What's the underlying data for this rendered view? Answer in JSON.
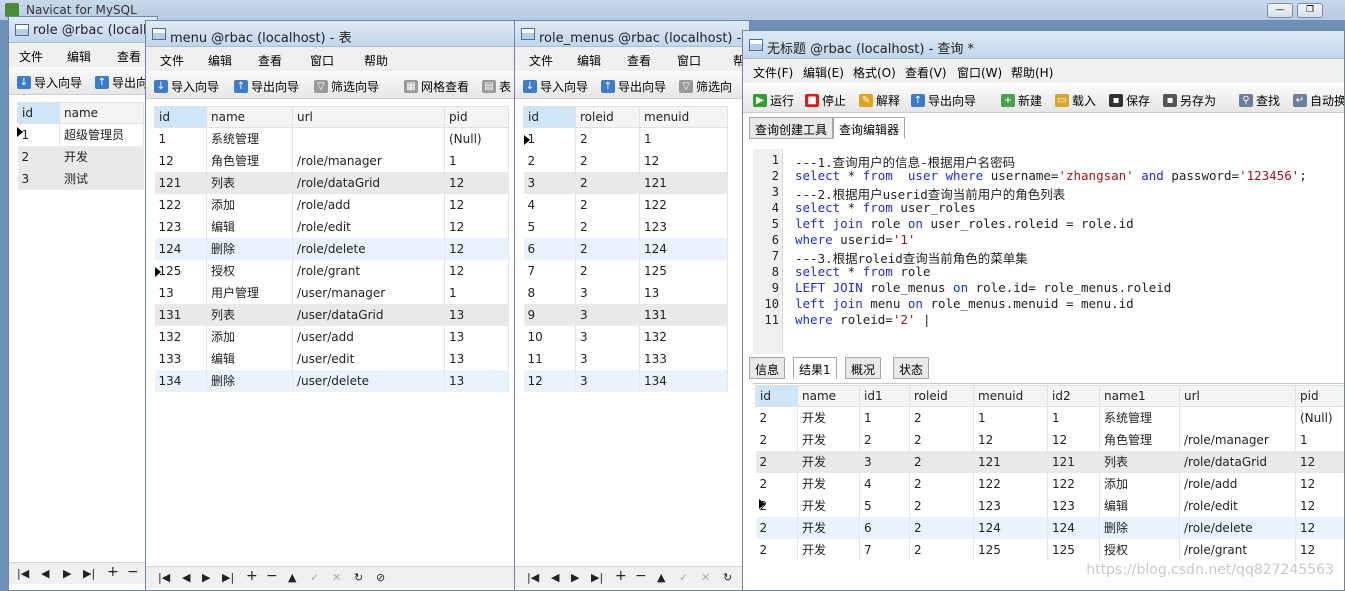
{
  "app": {
    "title": "Navicat for MySQL"
  },
  "role_window": {
    "title": "role @rbac (localhost)",
    "menu": [
      "文件",
      "编辑",
      "查看"
    ],
    "toolbar": [
      "导入向导",
      "导出向导"
    ],
    "columns": [
      "id",
      "name"
    ],
    "rows": [
      [
        "1",
        "超级管理员"
      ],
      [
        "2",
        "开发"
      ],
      [
        "3",
        "测试"
      ]
    ]
  },
  "menu_window": {
    "title": "menu @rbac (localhost) - 表",
    "menu": [
      "文件",
      "编辑",
      "查看",
      "窗口",
      "帮助"
    ],
    "toolbar": [
      "导入向导",
      "导出向导",
      "筛选向导",
      "网格查看",
      "表"
    ],
    "columns": [
      "id",
      "name",
      "url",
      "pid"
    ],
    "rows": [
      [
        "1",
        "系统管理",
        "",
        "(Null)"
      ],
      [
        "12",
        "角色管理",
        "/role/manager",
        "1"
      ],
      [
        "121",
        "列表",
        "/role/dataGrid",
        "12"
      ],
      [
        "122",
        "添加",
        "/role/add",
        "12"
      ],
      [
        "123",
        "编辑",
        "/role/edit",
        "12"
      ],
      [
        "124",
        "删除",
        "/role/delete",
        "12"
      ],
      [
        "125",
        "授权",
        "/role/grant",
        "12"
      ],
      [
        "13",
        "用户管理",
        "/user/manager",
        "1"
      ],
      [
        "131",
        "列表",
        "/user/dataGrid",
        "13"
      ],
      [
        "132",
        "添加",
        "/user/add",
        "13"
      ],
      [
        "133",
        "编辑",
        "/user/edit",
        "13"
      ],
      [
        "134",
        "删除",
        "/user/delete",
        "13"
      ]
    ]
  },
  "role_menus_window": {
    "title": "role_menus @rbac (localhost) - 表",
    "menu": [
      "文件",
      "编辑",
      "查看",
      "窗口",
      "帮"
    ],
    "toolbar": [
      "导入向导",
      "导出向导",
      "筛选向"
    ],
    "columns": [
      "id",
      "roleid",
      "menuid"
    ],
    "rows": [
      [
        "1",
        "2",
        "1"
      ],
      [
        "2",
        "2",
        "12"
      ],
      [
        "3",
        "2",
        "121"
      ],
      [
        "4",
        "2",
        "122"
      ],
      [
        "5",
        "2",
        "123"
      ],
      [
        "6",
        "2",
        "124"
      ],
      [
        "7",
        "2",
        "125"
      ],
      [
        "8",
        "3",
        "13"
      ],
      [
        "9",
        "3",
        "131"
      ],
      [
        "10",
        "3",
        "132"
      ],
      [
        "11",
        "3",
        "133"
      ],
      [
        "12",
        "3",
        "134"
      ]
    ]
  },
  "query_window": {
    "title": "无标题 @rbac (localhost) - 查询 *",
    "menu": [
      "文件(F)",
      "编辑(E)",
      "格式(O)",
      "查看(V)",
      "窗口(W)",
      "帮助(H)"
    ],
    "toolbar": [
      "运行",
      "停止",
      "解释",
      "导出向导",
      "新建",
      "载入",
      "保存",
      "另存为",
      "查找",
      "自动换"
    ],
    "editor_tabs": [
      "查询创建工具",
      "查询编辑器"
    ],
    "sql_lines": [
      {
        "n": "1",
        "html": "---1.查询用户的信息-根据用户名密码"
      },
      {
        "n": "2",
        "html": "<span class='kw'>select</span> * <span class='kw'>from</span>  <span class='kw'>user where</span> username=<span class='st'>'zhangsan'</span> <span class='kw'>and</span> password=<span class='st'>'123456'</span>;"
      },
      {
        "n": "3",
        "html": "---2.根据用户userid查询当前用户的角色列表"
      },
      {
        "n": "4",
        "html": "<span class='kw'>select</span> * <span class='kw'>from</span> user_roles"
      },
      {
        "n": "5",
        "html": "<span class='kw'>left join</span> role <span class='kw'>on</span> user_roles.roleid = role.id"
      },
      {
        "n": "6",
        "html": "<span class='kw'>where</span> userid=<span class='st'>'1'</span>"
      },
      {
        "n": "7",
        "html": "---3.根据roleid查询当前角色的菜单集"
      },
      {
        "n": "8",
        "html": "<span class='kw'>select</span> * <span class='kw'>from</span> role"
      },
      {
        "n": "9",
        "html": "<span class='kw'>LEFT JOIN</span> role_menus <span class='kw'>on</span> role.id= role_menus.roleid"
      },
      {
        "n": "10",
        "html": "<span class='kw'>left join</span> menu <span class='kw'>on</span> role_menus.menuid = menu.id"
      },
      {
        "n": "11",
        "html": "<span class='kw'>where</span> roleid=<span class='st'>'2'</span> |"
      }
    ],
    "result_tabs": [
      "信息",
      "结果1",
      "概况",
      "状态"
    ],
    "columns": [
      "id",
      "name",
      "id1",
      "roleid",
      "menuid",
      "id2",
      "name1",
      "url",
      "pid"
    ],
    "rows": [
      [
        "2",
        "开发",
        "1",
        "2",
        "1",
        "1",
        "系统管理",
        "",
        "(Null)"
      ],
      [
        "2",
        "开发",
        "2",
        "2",
        "12",
        "12",
        "角色管理",
        "/role/manager",
        "1"
      ],
      [
        "2",
        "开发",
        "3",
        "2",
        "121",
        "121",
        "列表",
        "/role/dataGrid",
        "12"
      ],
      [
        "2",
        "开发",
        "4",
        "2",
        "122",
        "122",
        "添加",
        "/role/add",
        "12"
      ],
      [
        "2",
        "开发",
        "5",
        "2",
        "123",
        "123",
        "编辑",
        "/role/edit",
        "12"
      ],
      [
        "2",
        "开发",
        "6",
        "2",
        "124",
        "124",
        "删除",
        "/role/delete",
        "12"
      ],
      [
        "2",
        "开发",
        "7",
        "2",
        "125",
        "125",
        "授权",
        "/role/grant",
        "12"
      ]
    ]
  },
  "watermark": "https://blog.csdn.net/qq827245563"
}
